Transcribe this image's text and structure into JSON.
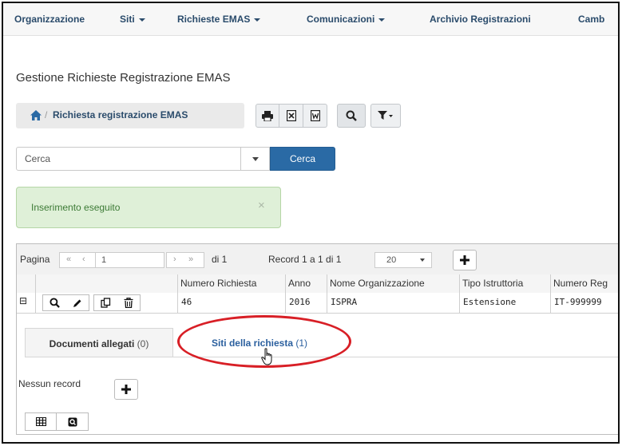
{
  "nav": {
    "items": [
      {
        "label": "Organizzazione",
        "caret": false
      },
      {
        "label": "Siti",
        "caret": true
      },
      {
        "label": "Richieste EMAS",
        "caret": true
      },
      {
        "label": "Comunicazioni",
        "caret": true
      },
      {
        "label": "Archivio Registrazioni",
        "caret": false
      },
      {
        "label": "Camb",
        "caret": false
      }
    ]
  },
  "page": {
    "title": "Gestione Richieste Registrazione EMAS"
  },
  "breadcrumb": {
    "icon": "home-icon",
    "label": "Richiesta registrazione EMAS"
  },
  "toolbar": {
    "icons": [
      "print-icon",
      "excel-icon",
      "word-icon",
      "search-icon",
      "filter-icon"
    ]
  },
  "search": {
    "value": "Cerca",
    "button_label": "Cerca"
  },
  "alert": {
    "message": "Inserimento eseguito",
    "close_symbol": "×"
  },
  "pager": {
    "page_label": "Pagina",
    "first": "«",
    "prev": "‹",
    "page_value": "1",
    "next": "›",
    "last": "»",
    "of_label": "di 1",
    "records_label": "Record 1 a 1 di 1",
    "page_size": "20"
  },
  "table": {
    "columns": [
      "Numero Richiesta",
      "Anno",
      "Nome Organizzazione",
      "Tipo Istruttoria",
      "Numero Reg"
    ],
    "rows": [
      {
        "expand": "⊟",
        "numero": "46",
        "anno": "2016",
        "organizzazione": "ISPRA",
        "tipo": "Estensione",
        "registrazione": "IT-999999"
      }
    ]
  },
  "tabs": [
    {
      "label": "Documenti allegati",
      "count": "(0)"
    },
    {
      "label": "Siti della richiesta",
      "count": "(1)"
    }
  ],
  "detail": {
    "empty_label": "Nessun record"
  },
  "colors": {
    "nav_text": "#2a4b6b",
    "primary": "#2a6aa5",
    "alert_bg": "#dff0d8",
    "highlight": "#d81f26"
  }
}
